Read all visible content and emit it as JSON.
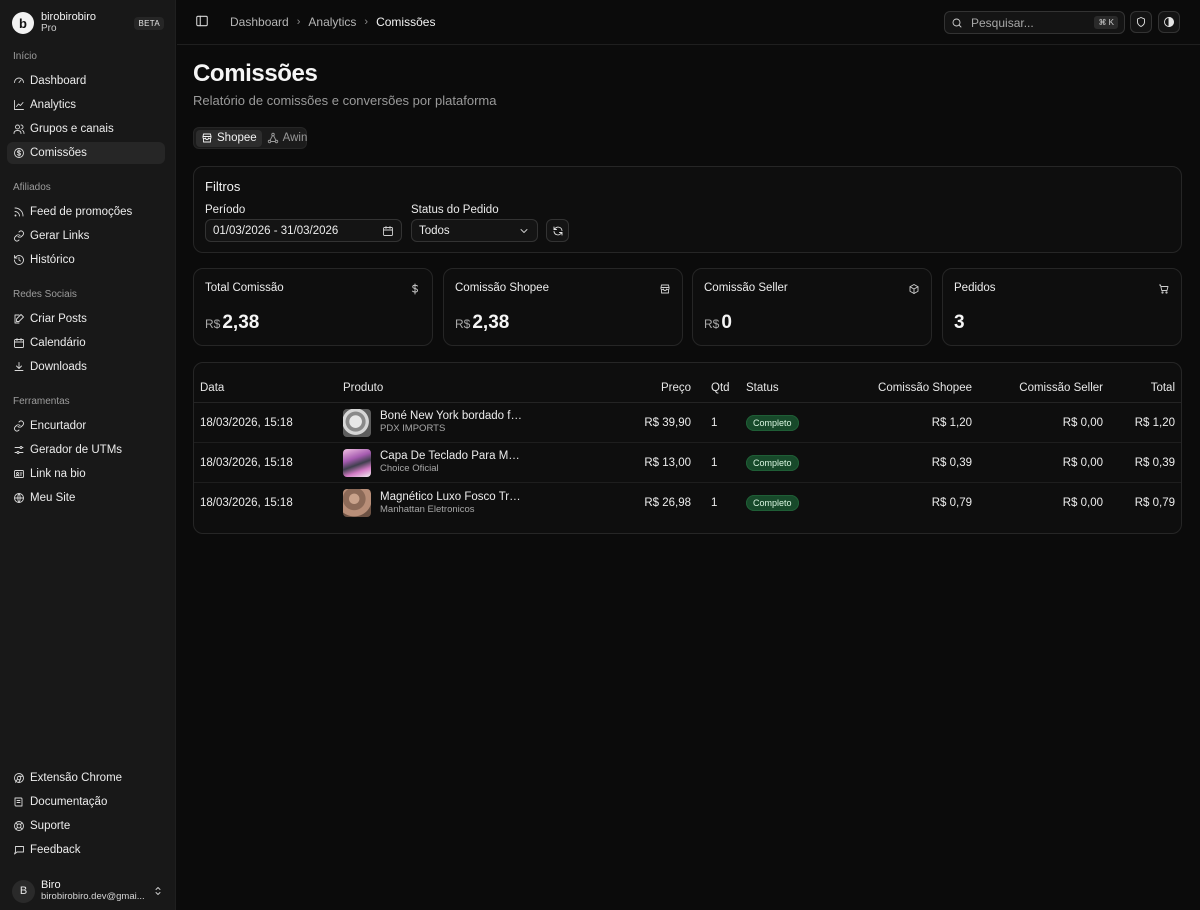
{
  "brand": {
    "name": "birobirobiro",
    "plan": "Pro",
    "badge": "BETA",
    "logo": "b"
  },
  "sidebar": {
    "sections": [
      {
        "label": "Início",
        "items": [
          {
            "label": "Dashboard",
            "icon": "gauge-icon"
          },
          {
            "label": "Analytics",
            "icon": "chart-line-icon"
          },
          {
            "label": "Grupos e canais",
            "icon": "users-icon"
          },
          {
            "label": "Comissões",
            "icon": "dollar-circle-icon",
            "active": true
          }
        ]
      },
      {
        "label": "Afiliados",
        "items": [
          {
            "label": "Feed de promoções",
            "icon": "rss-icon"
          },
          {
            "label": "Gerar Links",
            "icon": "link-icon"
          },
          {
            "label": "Histórico",
            "icon": "history-icon"
          }
        ]
      },
      {
        "label": "Redes Sociais",
        "items": [
          {
            "label": "Criar Posts",
            "icon": "edit-icon"
          },
          {
            "label": "Calendário",
            "icon": "calendar-icon"
          },
          {
            "label": "Downloads",
            "icon": "download-icon"
          }
        ]
      },
      {
        "label": "Ferramentas",
        "items": [
          {
            "label": "Encurtador",
            "icon": "link-icon"
          },
          {
            "label": "Gerador de UTMs",
            "icon": "sliders-icon"
          },
          {
            "label": "Link na bio",
            "icon": "id-card-icon"
          },
          {
            "label": "Meu Site",
            "icon": "globe-icon"
          }
        ]
      }
    ],
    "bottom_items": [
      {
        "label": "Extensão Chrome",
        "icon": "chrome-icon"
      },
      {
        "label": "Documentação",
        "icon": "book-icon"
      },
      {
        "label": "Suporte",
        "icon": "support-icon"
      },
      {
        "label": "Feedback",
        "icon": "message-icon"
      }
    ],
    "user": {
      "initial": "B",
      "name": "Biro",
      "email": "birobirobiro.dev@gmai..."
    }
  },
  "topbar": {
    "breadcrumb": [
      "Dashboard",
      "Analytics",
      "Comissões"
    ],
    "search_placeholder": "Pesquisar...",
    "search_shortcut": "⌘ K"
  },
  "page": {
    "title": "Comissões",
    "subtitle": "Relatório de comissões e conversões por plataforma",
    "tabs": [
      {
        "label": "Shopee",
        "active": true
      },
      {
        "label": "Awin",
        "active": false
      }
    ]
  },
  "filters": {
    "title": "Filtros",
    "period_label": "Período",
    "period_value": "01/03/2026 - 31/03/2026",
    "status_label": "Status do Pedido",
    "status_value": "Todos"
  },
  "stats": [
    {
      "label": "Total Comissão",
      "currency": "R$",
      "value": "2,38",
      "icon": "dollar-icon"
    },
    {
      "label": "Comissão Shopee",
      "currency": "R$",
      "value": "2,38",
      "icon": "store-icon"
    },
    {
      "label": "Comissão Seller",
      "currency": "R$",
      "value": "0",
      "icon": "package-icon"
    },
    {
      "label": "Pedidos",
      "currency": "",
      "value": "3",
      "icon": "cart-icon"
    }
  ],
  "table": {
    "headers": {
      "date": "Data",
      "product": "Produto",
      "price": "Preço",
      "qty": "Qtd",
      "status": "Status",
      "c_shopee": "Comissão Shopee",
      "c_seller": "Comissão Seller",
      "total": "Total"
    },
    "rows": [
      {
        "date": "18/03/2026, 15:18",
        "product": "Boné New York bordado fro...",
        "seller": "PDX IMPORTS",
        "price": "R$ 39,90",
        "qty": "1",
        "status": "Completo",
        "c_shopee": "R$ 1,20",
        "c_seller": "R$ 0,00",
        "total": "R$ 1,20"
      },
      {
        "date": "18/03/2026, 15:18",
        "product": "Capa De Teclado Para Mac...",
        "seller": "Choice Oficial",
        "price": "R$ 13,00",
        "qty": "1",
        "status": "Completo",
        "c_shopee": "R$ 0,39",
        "c_seller": "R$ 0,00",
        "total": "R$ 0,39"
      },
      {
        "date": "18/03/2026, 15:18",
        "product": "Magnético Luxo Fosco Tran...",
        "seller": "Manhattan Eletronicos",
        "price": "R$ 26,98",
        "qty": "1",
        "status": "Completo",
        "c_shopee": "R$ 0,79",
        "c_seller": "R$ 0,00",
        "total": "R$ 0,79"
      }
    ]
  },
  "colors": {
    "background": "#0b0b0b",
    "sidebar": "#181818",
    "status_completed": "#17492a"
  }
}
